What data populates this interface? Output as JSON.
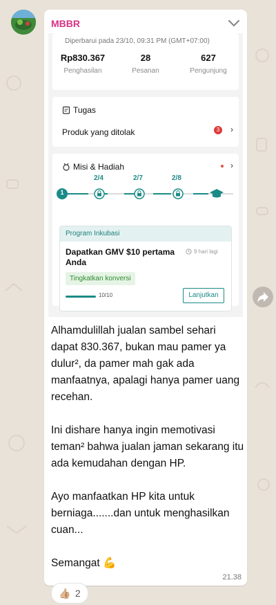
{
  "message": {
    "sender": "MBBR",
    "time": "21.38",
    "reaction": {
      "emoji_icon": "thumbs-up",
      "count": "2"
    },
    "caption": {
      "p1": "Alhamdulillah jualan sambel sehari dapat 830.367, bukan mau pamer ya dulur², da pamer mah gak ada manfaatnya, apalagi hanya pamer uang recehan.",
      "p2": "Ini dishare hanya ingin memotivasi teman² bahwa jualan jaman sekarang itu  ada kemudahan dengan HP.",
      "p3": "Ayo manfaatkan HP kita untuk berniaga.......dan untuk menghasilkan cuan...",
      "p4": "Semangat"
    }
  },
  "screenshot": {
    "updated": "Diperbarui pada 23/10, 09:31 PM (GMT+07:00)",
    "stats": [
      {
        "value": "Rp830.367",
        "label": "Penghasilan"
      },
      {
        "value": "28",
        "label": "Pesanan"
      },
      {
        "value": "627",
        "label": "Pengunjung"
      }
    ],
    "tasks": {
      "title": "Tugas",
      "item": "Produk yang ditolak",
      "badge": "3"
    },
    "mission": {
      "title": "Misi & Hadiah",
      "current_step": "1",
      "steps": [
        "2/4",
        "2/7",
        "2/8"
      ],
      "program": {
        "header": "Program Inkubasi",
        "title": "Dapatkan GMV $10 pertama Anda",
        "time_left": "9 hari lagi",
        "tag": "Tingkatkan konversi",
        "progress_fraction": 1.0,
        "progress_text": "10/10",
        "button": "Lanjutkan"
      }
    }
  },
  "colors": {
    "sender": "#d63384",
    "accent": "#1a8a86",
    "badge": "#e03a3a"
  }
}
